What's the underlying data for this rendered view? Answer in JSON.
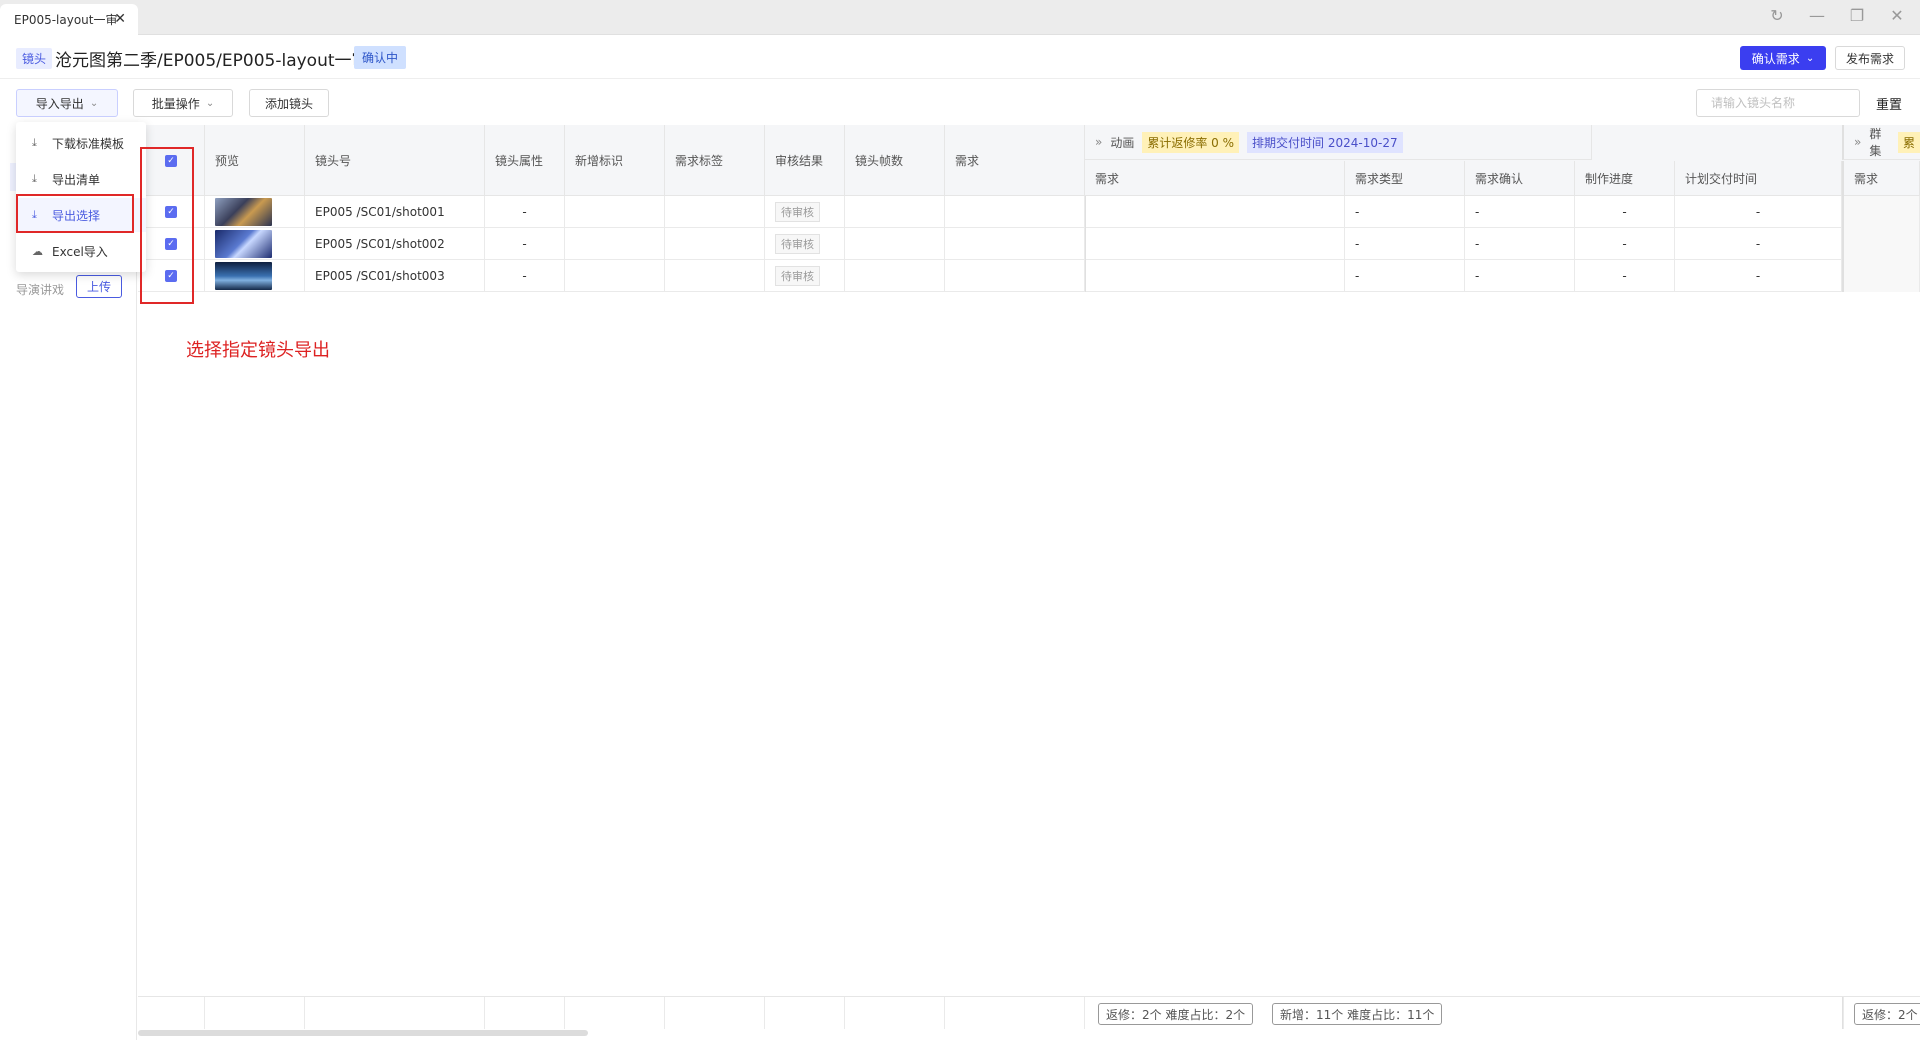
{
  "window": {
    "tab_title": "EP005-layout一审",
    "close_glyph": "✕",
    "refresh_glyph": "↻",
    "minimize_glyph": "—",
    "restore_glyph": "❐",
    "closewin_glyph": "✕"
  },
  "header": {
    "type_tag": "镜头",
    "breadcrumb": "沧元图第二季/EP005/EP005-layout一审",
    "status": "确认中",
    "confirm_button": "确认需求",
    "publish_button": "发布需求"
  },
  "toolbar": {
    "import_export": "导入导出",
    "batch": "批量操作",
    "add_shot": "添加镜头",
    "search_placeholder": "请输入镜头名称",
    "reset": "重置"
  },
  "dropdown": {
    "items": [
      {
        "label": "下载标准模板",
        "icon": "download-icon"
      },
      {
        "label": "导出清单",
        "icon": "download-icon"
      },
      {
        "label": "导出选择",
        "icon": "download-icon"
      },
      {
        "label": "Excel导入",
        "icon": "cloud-upload-icon"
      }
    ]
  },
  "sidebar": {
    "label": "导演讲戏",
    "upload": "上传"
  },
  "table": {
    "columns": [
      "预览",
      "镜头号",
      "镜头属性",
      "新增标识",
      "需求标签",
      "审核结果",
      "镜头帧数",
      "需求"
    ],
    "group_animation": {
      "name": "动画",
      "fix_rate": "累计返修率 0 %",
      "delivery": "排期交付时间 2024-10-27",
      "subcolumns": [
        "需求",
        "需求类型",
        "需求确认",
        "制作进度",
        "计划交付时间"
      ]
    },
    "group_crowd": {
      "name": "群集",
      "subcolumn": "需求",
      "badge": "累"
    },
    "rows": [
      {
        "shot": "EP005 /SC01/shot001",
        "attr": "-",
        "review": "待审核",
        "anim": [
          "-",
          "-",
          "-",
          "-"
        ],
        "thumb_color": "#4a5a7a"
      },
      {
        "shot": "EP005 /SC01/shot002",
        "attr": "-",
        "review": "待审核",
        "anim": [
          "-",
          "-",
          "-",
          "-"
        ],
        "thumb_color": "#3b4fa0"
      },
      {
        "shot": "EP005 /SC01/shot003",
        "attr": "-",
        "review": "待审核",
        "anim": [
          "-",
          "-",
          "-",
          "-"
        ],
        "thumb_color": "#2f5b8a"
      }
    ],
    "check_glyph": "✓"
  },
  "annotation": "选择指定镜头导出",
  "footer": {
    "anim_fix": "返修：2个  难度占比：2个",
    "anim_new": "新增：11个  难度占比：11个",
    "crowd_fix": "返修：2个"
  }
}
